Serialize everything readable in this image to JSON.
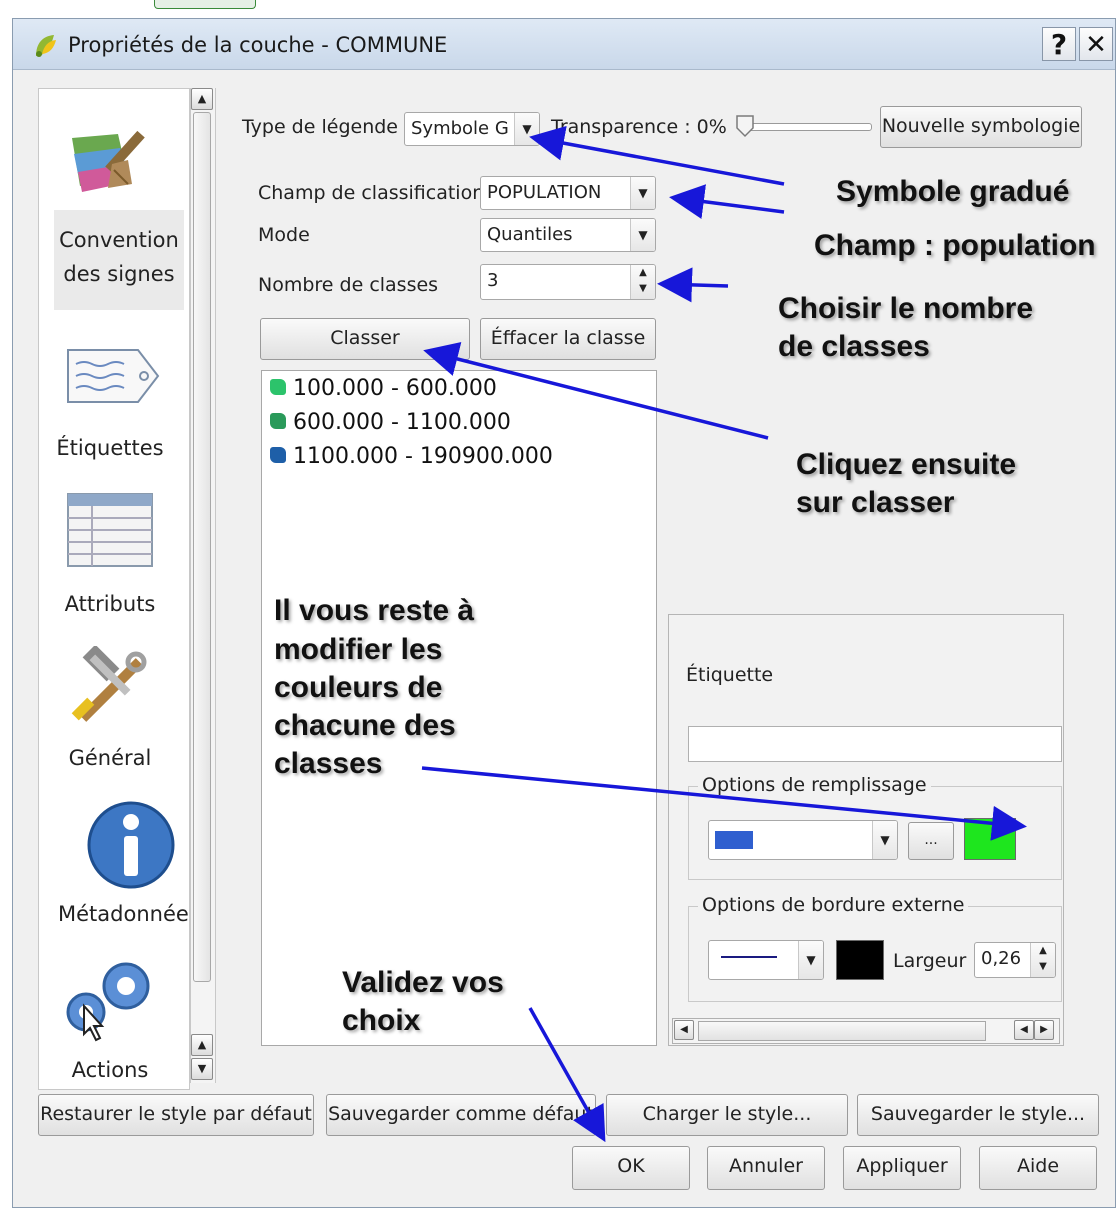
{
  "window": {
    "title": "Propriétés de la couche - COMMUNE",
    "help_glyph": "?",
    "close_glyph": "✕"
  },
  "sidebar": {
    "items": [
      {
        "label_line1": "Convention",
        "label_line2": "des signes",
        "icon": "paintbrush-icon"
      },
      {
        "label": "Étiquettes",
        "icon": "label-tag-icon"
      },
      {
        "label": "Attributs",
        "icon": "table-icon"
      },
      {
        "label": "Général",
        "icon": "tools-icon"
      },
      {
        "label": "Métadonnée",
        "icon": "info-icon"
      },
      {
        "label": "Actions",
        "icon": "gears-icon"
      }
    ]
  },
  "symbology": {
    "legend_type_label": "Type de légende",
    "legend_type_value": "Symbole G",
    "transparency_label": "Transparence : 0%",
    "transparency_value": 0,
    "new_symbology_button": "Nouvelle symbologie",
    "classification_field_label": "Champ de classificatior",
    "classification_field_value": "POPULATION",
    "mode_label": "Mode",
    "mode_value": "Quantiles",
    "class_count_label": "Nombre de classes",
    "class_count_value": "3",
    "classify_button": "Classer",
    "clear_class_button": "Éffacer la classe",
    "classes": [
      {
        "label": "100.000 - 600.000",
        "color": "#2cc36b"
      },
      {
        "label": "600.000 - 1100.000",
        "color": "#2a9a5a"
      },
      {
        "label": "1100.000 - 190900.000",
        "color": "#1e5fa8"
      }
    ]
  },
  "symbol_panel": {
    "label_title": "Étiquette",
    "label_value": "",
    "fill_options_title": "Options de remplissage",
    "fill_style_color": "#2f5fcf",
    "fill_more_button": "...",
    "fill_color": "#1ee61e",
    "border_options_title": "Options de bordure externe",
    "border_color": "#000000",
    "width_label": "Largeur",
    "width_value": "0,26"
  },
  "annotations": {
    "graduated": "Symbole gradué",
    "field": "Champ : population",
    "choose_line1": "Choisir le nombre",
    "choose_line2": "de classes",
    "click_line1": "Cliquez ensuite",
    "click_line2": "sur classer",
    "modify_line1": "Il vous reste à",
    "modify_line2": "modifier les",
    "modify_line3": "couleurs de",
    "modify_line4": "chacune des",
    "modify_line5": "classes",
    "validate_line1": "Validez vos",
    "validate_line2": "choix",
    "arrow_color": "#1717d9"
  },
  "footer": {
    "restore_default": "Restaurer le style par défaut",
    "save_default": "Sauvegarder comme défaut",
    "load_style": "Charger le style...",
    "save_style": "Sauvegarder le style...",
    "ok": "OK",
    "cancel": "Annuler",
    "apply": "Appliquer",
    "help": "Aide"
  }
}
